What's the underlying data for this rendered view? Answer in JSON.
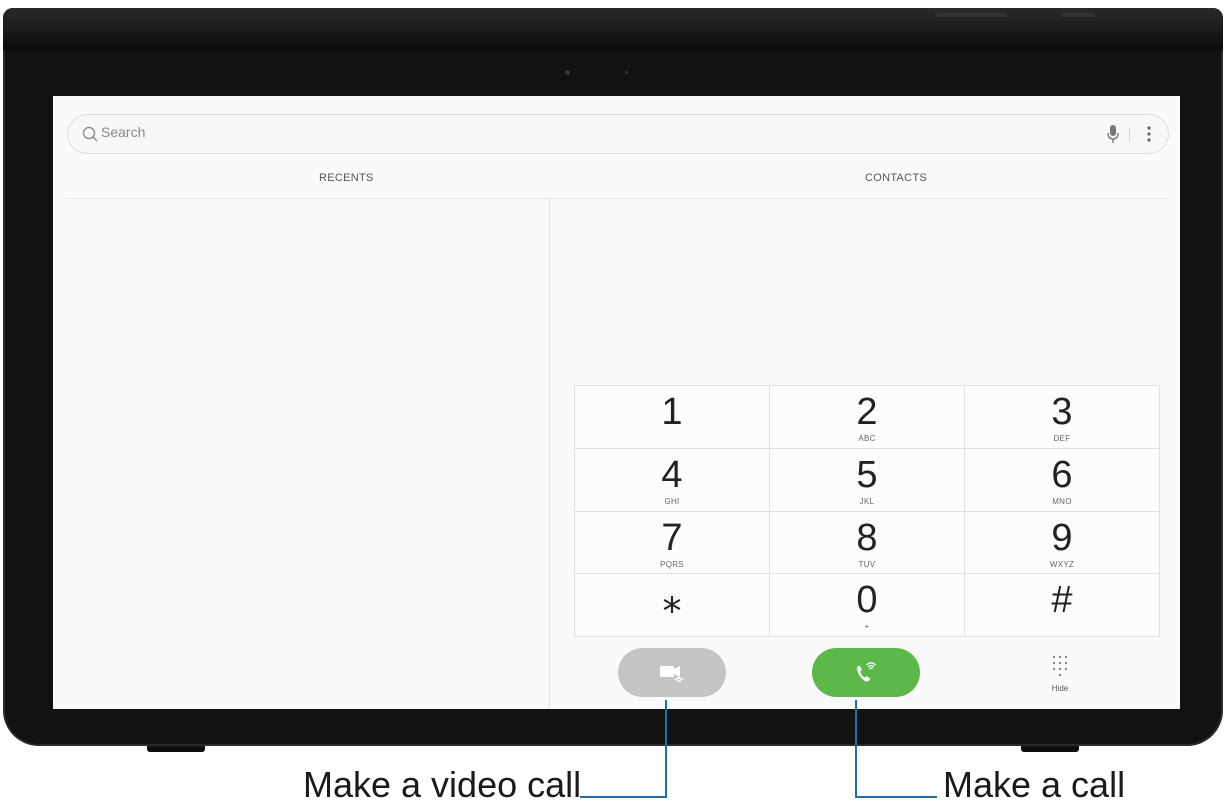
{
  "search": {
    "placeholder": "Search"
  },
  "tabs": [
    {
      "label": "RECENTS"
    },
    {
      "label": "CONTACTS"
    }
  ],
  "keypad": {
    "keys": [
      {
        "digit": "1",
        "letters": ""
      },
      {
        "digit": "2",
        "letters": "ABC"
      },
      {
        "digit": "3",
        "letters": "DEF"
      },
      {
        "digit": "4",
        "letters": "GHI"
      },
      {
        "digit": "5",
        "letters": "JKL"
      },
      {
        "digit": "6",
        "letters": "MNO"
      },
      {
        "digit": "7",
        "letters": "PQRS"
      },
      {
        "digit": "8",
        "letters": "TUV"
      },
      {
        "digit": "9",
        "letters": "WXYZ"
      },
      {
        "digit": "⁎",
        "letters": ""
      },
      {
        "digit": "0",
        "letters": "+"
      },
      {
        "digit": "#",
        "letters": ""
      }
    ]
  },
  "actions": {
    "hide_label": "Hide"
  },
  "annotations": {
    "video_call": "Make a video call",
    "call": "Make a call"
  },
  "colors": {
    "call_button": "#5cb848",
    "video_button": "#c4c4c4",
    "callout_line": "#1d6fa8"
  },
  "icons": {
    "search": "search-icon",
    "mic": "microphone-icon",
    "more": "more-options-icon",
    "video": "video-call-icon",
    "call": "phone-call-icon",
    "dialpad": "dialpad-icon"
  }
}
